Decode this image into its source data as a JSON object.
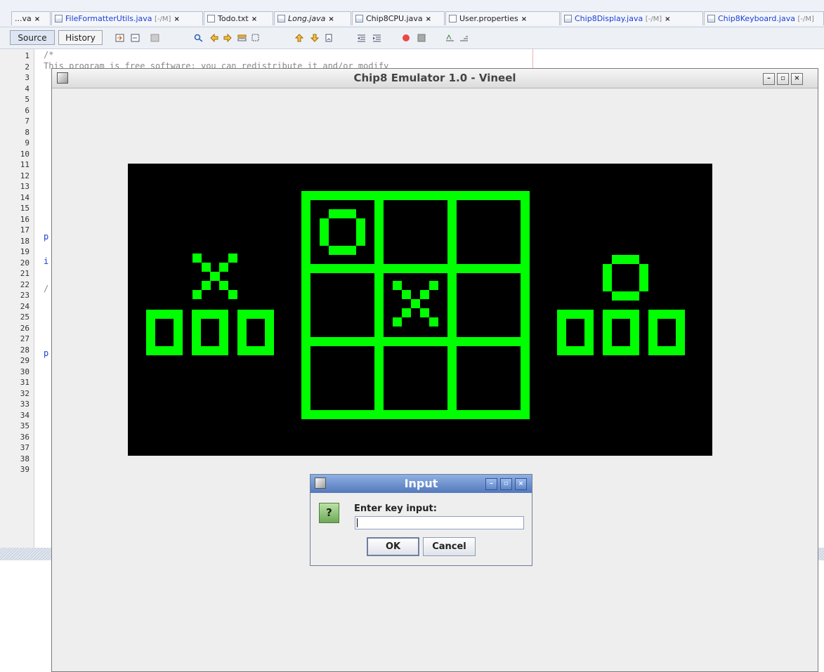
{
  "ide": {
    "tabs": [
      {
        "label": "...va",
        "modifier": ""
      },
      {
        "label": "FileFormatterUtils.java",
        "modifier": "[-/M]"
      },
      {
        "label": "Todo.txt",
        "modifier": ""
      },
      {
        "label": "Long.java",
        "modifier": ""
      },
      {
        "label": "Chip8CPU.java",
        "modifier": ""
      },
      {
        "label": "User.properties",
        "modifier": ""
      },
      {
        "label": "Chip8Display.java",
        "modifier": "[-/M]"
      },
      {
        "label": "Chip8Keyboard.java",
        "modifier": "[-/M]"
      }
    ],
    "close_glyph": "×",
    "source_label": "Source",
    "history_label": "History",
    "line_numbers": [
      "1",
      "2",
      "3",
      "4",
      "5",
      "6",
      "7",
      "8",
      "9",
      "10",
      "11",
      "12",
      "13",
      "14",
      "15",
      "16",
      "17",
      "18",
      "19",
      "20",
      "21",
      "22",
      "23",
      "24",
      "25",
      "26",
      "27",
      "28",
      "29",
      "30",
      "31",
      "32",
      "33",
      "34",
      "35",
      "36",
      "37",
      "38",
      "39"
    ],
    "code_fragments": {
      "line1": "/*",
      "line2": "   This program is free software: you can redistribute it and/or modify",
      "line15": "p",
      "line17": "i",
      "line19": "/",
      "line24": "p"
    }
  },
  "emulator": {
    "title": "Chip8 Emulator 1.0 - Vineel",
    "minimize_glyph": "–",
    "maximize_glyph": "▫",
    "close_glyph": "×",
    "screen": {
      "background": "#000000",
      "pixel_color": "#00ff00",
      "board": [
        [
          "O",
          "",
          ""
        ],
        [
          "",
          "X",
          ""
        ],
        [
          "",
          "",
          ""
        ]
      ],
      "left_player": {
        "symbol": "X",
        "score_digits": 3
      },
      "right_player": {
        "symbol": "O",
        "score_digits": 3
      }
    }
  },
  "dialog": {
    "title": "Input",
    "icon": "?",
    "prompt": "Enter key input:",
    "input_value": "",
    "ok_label": "OK",
    "cancel_label": "Cancel",
    "minimize_glyph": "–",
    "maximize_glyph": "▫",
    "close_glyph": "×"
  },
  "colors": {
    "title_bar_active": "#5378bc",
    "link_blue": "#1a3fd6",
    "chip8_green": "#00ff00"
  }
}
